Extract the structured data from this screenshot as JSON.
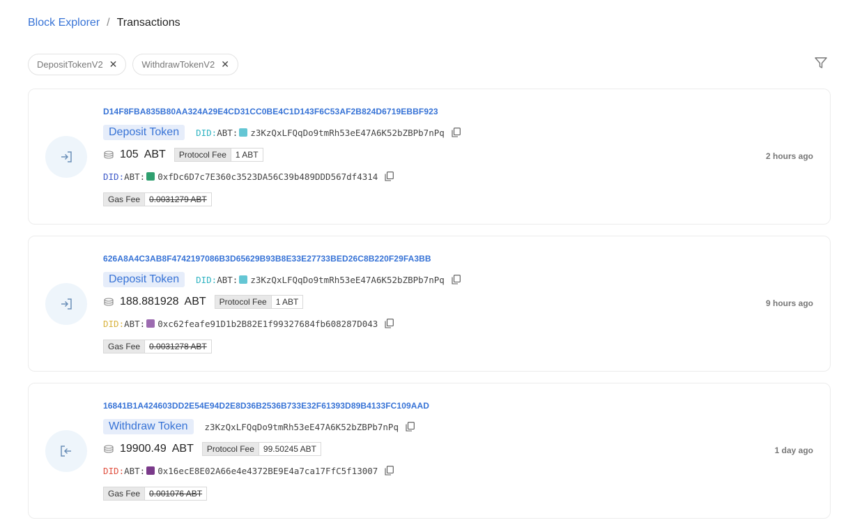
{
  "breadcrumb": {
    "root": "Block Explorer",
    "separator": "/",
    "current": "Transactions"
  },
  "filters": [
    {
      "label": "DepositTokenV2",
      "remove": "✕"
    },
    {
      "label": "WithdrawTokenV2",
      "remove": "✕"
    }
  ],
  "icons": {
    "filter": "filter-icon",
    "copy": "copy-icon",
    "coins": "coins-icon",
    "deposit": "deposit-arrow-icon",
    "withdraw": "withdraw-arrow-icon"
  },
  "colors": {
    "accent": "#3773d6",
    "badge_bg": "#e6edfa",
    "circle_bg": "#eef5fb"
  },
  "transactions": [
    {
      "hash": "D14F8FBA835B80AA324A29E4CD31CC0BE4C1D143F6C53AF2B824D6719EBBF923",
      "type": "Deposit Token",
      "direction": "deposit",
      "from_did": "DID:",
      "from_abt": "ABT:",
      "from_address": "z3KzQxLFQqDo9tmRh53eE47A6K52bZBPb7nPq",
      "amount": "105",
      "unit": "ABT",
      "protocol_fee_label": "Protocol Fee",
      "protocol_fee": "1 ABT",
      "to_did": "DID:",
      "to_abt": "ABT:",
      "to_address": "0xfDc6D7c7E360c3523DA56C39b489DDD567df4314",
      "gas_fee_label": "Gas Fee",
      "gas_fee": "0.0031279 ABT",
      "time": "2 hours ago"
    },
    {
      "hash": "626A8A4C3AB8F4742197086B3D65629B93B8E33E27733BED26C8B220F29FA3BB",
      "type": "Deposit Token",
      "direction": "deposit",
      "from_did": "DID:",
      "from_abt": "ABT:",
      "from_address": "z3KzQxLFQqDo9tmRh53eE47A6K52bZBPb7nPq",
      "amount": "188.881928",
      "unit": "ABT",
      "protocol_fee_label": "Protocol Fee",
      "protocol_fee": "1 ABT",
      "to_did": "DID:",
      "to_abt": "ABT:",
      "to_address": "0xc62feafe91D1b2B82E1f99327684fb608287D043",
      "gas_fee_label": "Gas Fee",
      "gas_fee": "0.0031278 ABT",
      "time": "9 hours ago"
    },
    {
      "hash": "16841B1A424603DD2E54E94D2E8D36B2536B733E32F61393D89B4133FC109AAD",
      "type": "Withdraw Token",
      "direction": "withdraw",
      "from_address": "z3KzQxLFQqDo9tmRh53eE47A6K52bZBPb7nPq",
      "amount": "19900.49",
      "unit": "ABT",
      "protocol_fee_label": "Protocol Fee",
      "protocol_fee": "99.50245 ABT",
      "to_did": "DID:",
      "to_abt": "ABT:",
      "to_address": "0x16ecE8E02A66e4e4372BE9E4a7ca17FfC5f13007",
      "gas_fee_label": "Gas Fee",
      "gas_fee": "0.001076 ABT",
      "time": "1 day ago"
    }
  ]
}
